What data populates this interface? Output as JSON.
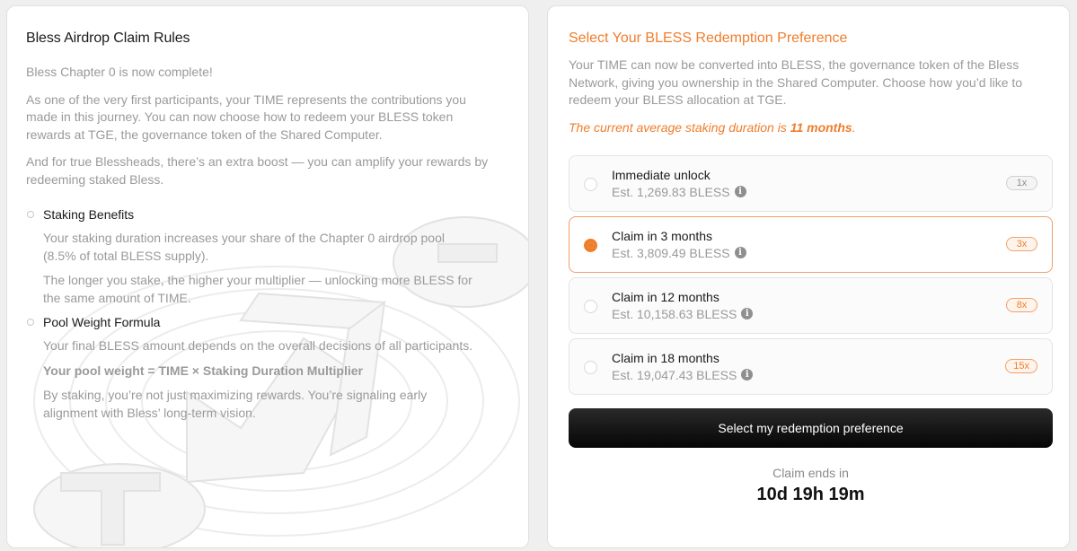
{
  "rules": {
    "title": "Bless Airdrop Claim Rules",
    "paragraphs": [
      "Bless Chapter 0 is now complete!",
      "As one of the very first participants, your TIME represents the contributions you made in this journey. You can now choose how to redeem your BLESS token rewards at TGE, the governance token of the Shared Computer.",
      "And for true Blessheads, there’s an extra boost — you can amplify your rewards by redeeming staked Bless."
    ],
    "sections": [
      {
        "title": "Staking Benefits",
        "paragraphs": [
          "Your staking duration increases your share of the Chapter 0 airdrop pool (8.5% of total BLESS supply).",
          "The longer you stake, the higher your multiplier — unlocking more BLESS for the same amount of TIME."
        ]
      },
      {
        "title": "Pool Weight Formula",
        "paragraphs": [
          "Your final BLESS amount depends on the overall decisions of all participants.",
          "Your pool weight = TIME × Staking Duration Multiplier",
          "By staking, you’re not just maximizing rewards. You’re signaling early alignment with Bless’ long-term vision."
        ]
      }
    ]
  },
  "redemption": {
    "title": "Select Your BLESS Redemption Preference",
    "description": "Your TIME can now be converted into BLESS, the governance token of the Bless Network, giving you ownership in the Shared Computer. Choose how you’d like to redeem your BLESS allocation at TGE.",
    "note_prefix": "The current average staking duration is ",
    "note_value": "11 months",
    "note_suffix": ".",
    "options": [
      {
        "label": "Immediate unlock",
        "estimate": "Est. 1,269.83 BLESS",
        "multiplier": "1x",
        "selected": false
      },
      {
        "label": "Claim in 3 months",
        "estimate": "Est. 3,809.49 BLESS",
        "multiplier": "3x",
        "selected": true
      },
      {
        "label": "Claim in 12 months",
        "estimate": "Est. 10,158.63 BLESS",
        "multiplier": "8x",
        "selected": false
      },
      {
        "label": "Claim in 18 months",
        "estimate": "Est. 19,047.43 BLESS",
        "multiplier": "15x",
        "selected": false
      }
    ],
    "cta_label": "Select my redemption preference",
    "claim_ends_label": "Claim ends in",
    "countdown": "10d 19h 19m"
  },
  "colors": {
    "accent": "#ef7d2c",
    "muted_text": "#9a9a9a",
    "button_bg": "#111111"
  }
}
